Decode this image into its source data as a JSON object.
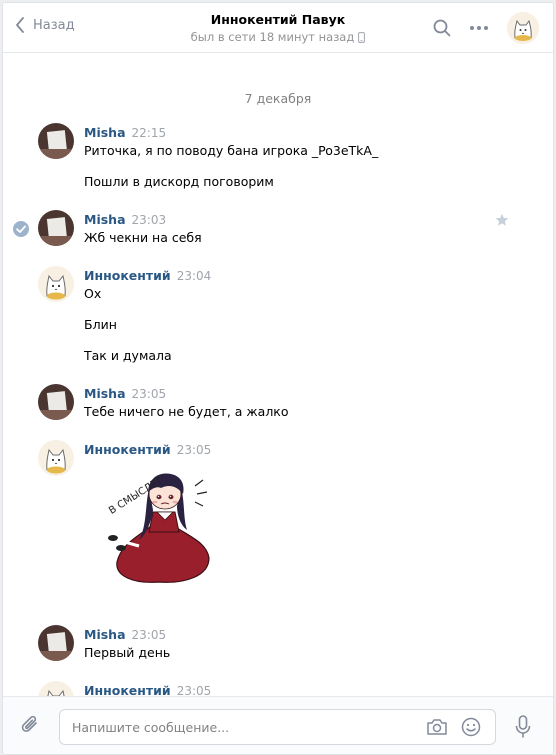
{
  "header": {
    "back_label": "Назад",
    "title": "Иннокентий Павук",
    "status": "был в сети 18 минут назад"
  },
  "feed": {
    "date": "7 декабря",
    "messages": [
      {
        "author": "Misha",
        "time": "22:15",
        "lines": [
          "Риточка, я по поводу бана игрока _Po3eTkA_",
          "Пошли в дискорд поговорим"
        ]
      },
      {
        "author": "Misha",
        "time": "23:03",
        "lines": [
          "Жб чекни на себя"
        ]
      },
      {
        "author": "Иннокентий",
        "time": "23:04",
        "lines": [
          "Ох",
          "Блин",
          "Так и думала"
        ]
      },
      {
        "author": "Misha",
        "time": "23:05",
        "lines": [
          "Тебе ничего не будет, а жалко"
        ]
      },
      {
        "author": "Иннокентий",
        "time": "23:05",
        "sticker_text": "В СМЫСЛЕ?"
      },
      {
        "author": "Misha",
        "time": "23:05",
        "lines": [
          "Первый день"
        ]
      },
      {
        "author": "Иннокентий",
        "time": "23:05"
      }
    ]
  },
  "composer": {
    "placeholder": "Напишите сообщение..."
  },
  "colors": {
    "link": "#2a5885",
    "muted": "#828a99",
    "border": "#e7e8ec",
    "sticker_dress": "#9a1f2c"
  },
  "icons": [
    "chevron-left-icon",
    "phone-icon",
    "search-icon",
    "more-icon",
    "check-icon",
    "star-icon",
    "paperclip-icon",
    "camera-icon",
    "smile-icon",
    "microphone-icon"
  ]
}
